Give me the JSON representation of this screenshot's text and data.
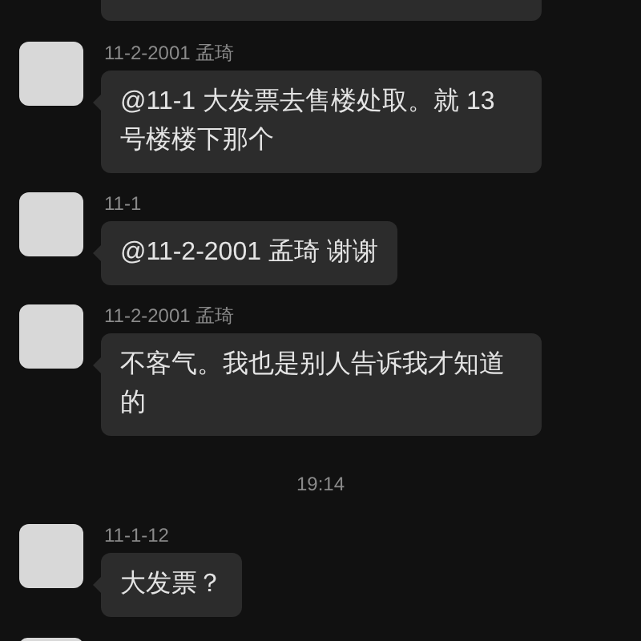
{
  "messages": [
    {
      "kind": "cut"
    },
    {
      "kind": "message",
      "sender": "11-2-2001 孟琦",
      "text": "@11-1  大发票去售楼处取。就 13 号楼楼下那个"
    },
    {
      "kind": "message",
      "sender": "11-1",
      "text": "@11-2-2001 孟琦  谢谢"
    },
    {
      "kind": "message",
      "sender": "11-2-2001 孟琦",
      "text": "不客气。我也是别人告诉我才知道的"
    },
    {
      "kind": "time",
      "text": "19:14"
    },
    {
      "kind": "message",
      "sender": "11-1-12",
      "text": "大发票？"
    },
    {
      "kind": "edge"
    }
  ]
}
